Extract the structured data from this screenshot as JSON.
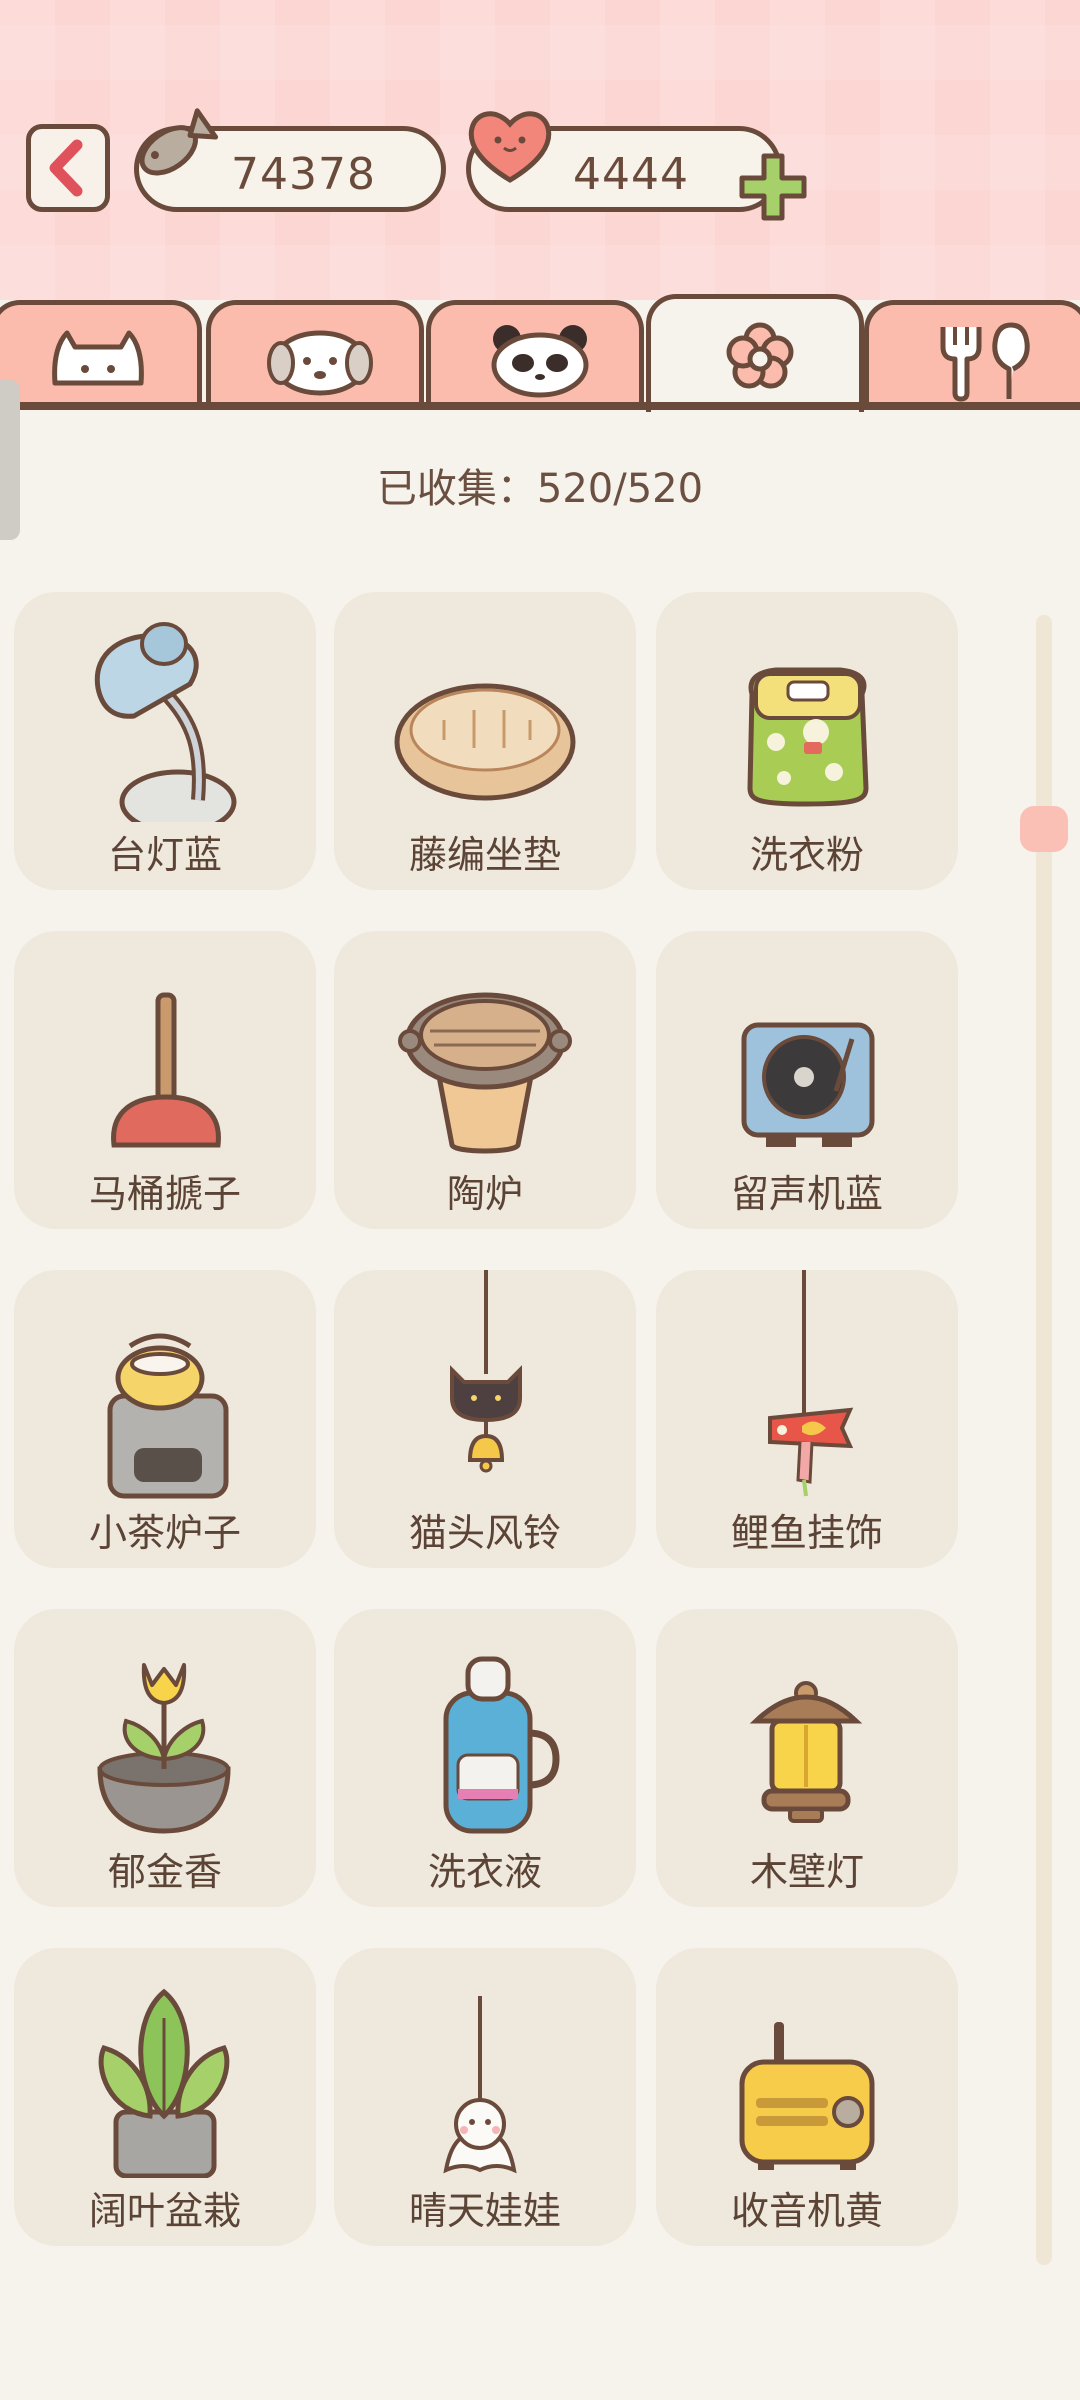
{
  "header": {
    "fish_count": "74378",
    "heart_count": "4444"
  },
  "tabs": [
    {
      "icon": "cat-face-icon"
    },
    {
      "icon": "dog-face-icon"
    },
    {
      "icon": "panda-face-icon"
    },
    {
      "icon": "flower-icon",
      "active": true
    },
    {
      "icon": "fork-spoon-icon"
    }
  ],
  "collected_text": "已收集：520/520",
  "items": [
    {
      "label": "台灯蓝",
      "icon": "desk-lamp-blue-icon"
    },
    {
      "label": "藤编坐垫",
      "icon": "rattan-cushion-icon"
    },
    {
      "label": "洗衣粉",
      "icon": "detergent-powder-icon"
    },
    {
      "label": "马桶搋子",
      "icon": "plunger-icon"
    },
    {
      "label": "陶炉",
      "icon": "clay-stove-icon"
    },
    {
      "label": "留声机蓝",
      "icon": "record-player-blue-icon"
    },
    {
      "label": "小茶炉子",
      "icon": "tea-stove-icon"
    },
    {
      "label": "猫头风铃",
      "icon": "cat-wind-chime-icon"
    },
    {
      "label": "鲤鱼挂饰",
      "icon": "carp-streamer-icon"
    },
    {
      "label": "郁金香",
      "icon": "tulip-pot-icon"
    },
    {
      "label": "洗衣液",
      "icon": "laundry-liquid-icon"
    },
    {
      "label": "木壁灯",
      "icon": "wood-wall-lamp-icon"
    },
    {
      "label": "阔叶盆栽",
      "icon": "broadleaf-plant-icon"
    },
    {
      "label": "晴天娃娃",
      "icon": "teru-teru-bozu-icon"
    },
    {
      "label": "收音机黄",
      "icon": "radio-yellow-icon"
    }
  ],
  "colors": {
    "accent_pink": "#fbbcae",
    "outline_brown": "#6a4a3b",
    "card_bg": "#efe8dc",
    "plus_green": "#a5d06a"
  }
}
